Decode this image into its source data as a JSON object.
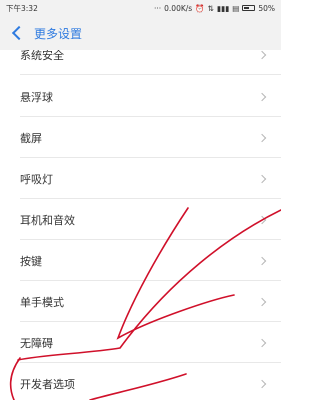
{
  "status_bar": {
    "time": "下午3:32",
    "network_speed": "0.00K/s",
    "battery_text": "50%"
  },
  "header": {
    "title": "更多设置"
  },
  "settings": {
    "items": [
      {
        "label": "系统安全"
      },
      {
        "label": "悬浮球"
      },
      {
        "label": "截屏"
      },
      {
        "label": "呼吸灯"
      },
      {
        "label": "耳机和音效"
      },
      {
        "label": "按键"
      },
      {
        "label": "单手模式"
      },
      {
        "label": "无障碍"
      },
      {
        "label": "开发者选项"
      }
    ]
  },
  "colors": {
    "accent": "#2f7be0",
    "annotation_stroke": "#d0102a"
  }
}
